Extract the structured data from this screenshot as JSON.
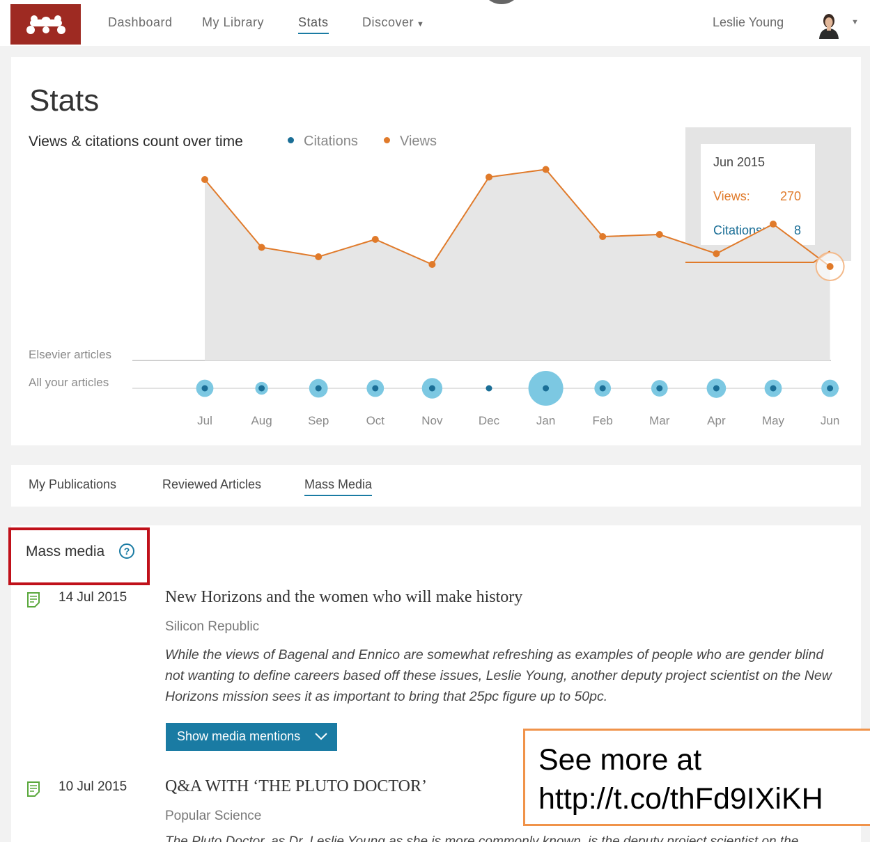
{
  "nav": {
    "items": [
      "Dashboard",
      "My Library",
      "Stats",
      "Discover"
    ],
    "active": "Stats",
    "user_name": "Leslie Young"
  },
  "stats": {
    "title": "Stats",
    "chart_heading": "Views & citations count over time",
    "row_labels": [
      "Elsevier articles",
      "All your articles"
    ],
    "tooltip": {
      "month": "Jun 2015",
      "views_label": "Views:",
      "views_value": "270",
      "citations_label": "Citations:",
      "citations_value": "8"
    }
  },
  "colors": {
    "views": "#e07a2a",
    "citations": "#1a6e96",
    "citation_bubble": "#7cc8e2",
    "accent": "#1a7ba3",
    "logo": "#9e2a22",
    "highlight_box": "#c0111a",
    "overlay_border": "#f0934a"
  },
  "chart_data": {
    "type": "line",
    "categories": [
      "Jul",
      "Aug",
      "Sep",
      "Oct",
      "Nov",
      "Dec",
      "Jan",
      "Feb",
      "Mar",
      "Apr",
      "May",
      "Jun"
    ],
    "legend": [
      "Citations",
      "Views"
    ],
    "series": [
      {
        "name": "Views",
        "values": [
          520,
          325,
          298,
          348,
          276,
          527,
          549,
          356,
          362,
          307,
          392,
          270
        ]
      },
      {
        "name": "Citations",
        "values": [
          8,
          3,
          10,
          8,
          13,
          2,
          50,
          7,
          7,
          11,
          8,
          8
        ]
      }
    ],
    "ylim": [
      0,
      600
    ],
    "grid": false,
    "legend_placement": "top"
  },
  "tabs": [
    "My Publications",
    "Reviewed Articles",
    "Mass Media"
  ],
  "tabs_active": "Mass Media",
  "mass_media": {
    "title": "Mass media",
    "help": "?",
    "items": [
      {
        "date": "14 Jul 2015",
        "title": "New Horizons and the women who will make history",
        "source": "Silicon Republic",
        "snippet": "While the views of Bagenal and Ennico are somewhat refreshing as examples of people who are gender blind not wanting to define careers based off these issues, Leslie Young, another deputy project scientist on the New Horizons mission sees it as important to bring that 25pc figure up to 50pc.",
        "button": "Show media mentions"
      },
      {
        "date": "10 Jul 2015",
        "title": "Q&A WITH ‘THE PLUTO DOCTOR’",
        "source": "Popular Science",
        "snippet": "The Pluto Doctor, as Dr. Leslie Young as she is more commonly known, is the deputy project scientist on the"
      }
    ]
  },
  "overlay": {
    "line1": "See more at",
    "line2": "http://t.co/thFd9IXiKH"
  }
}
